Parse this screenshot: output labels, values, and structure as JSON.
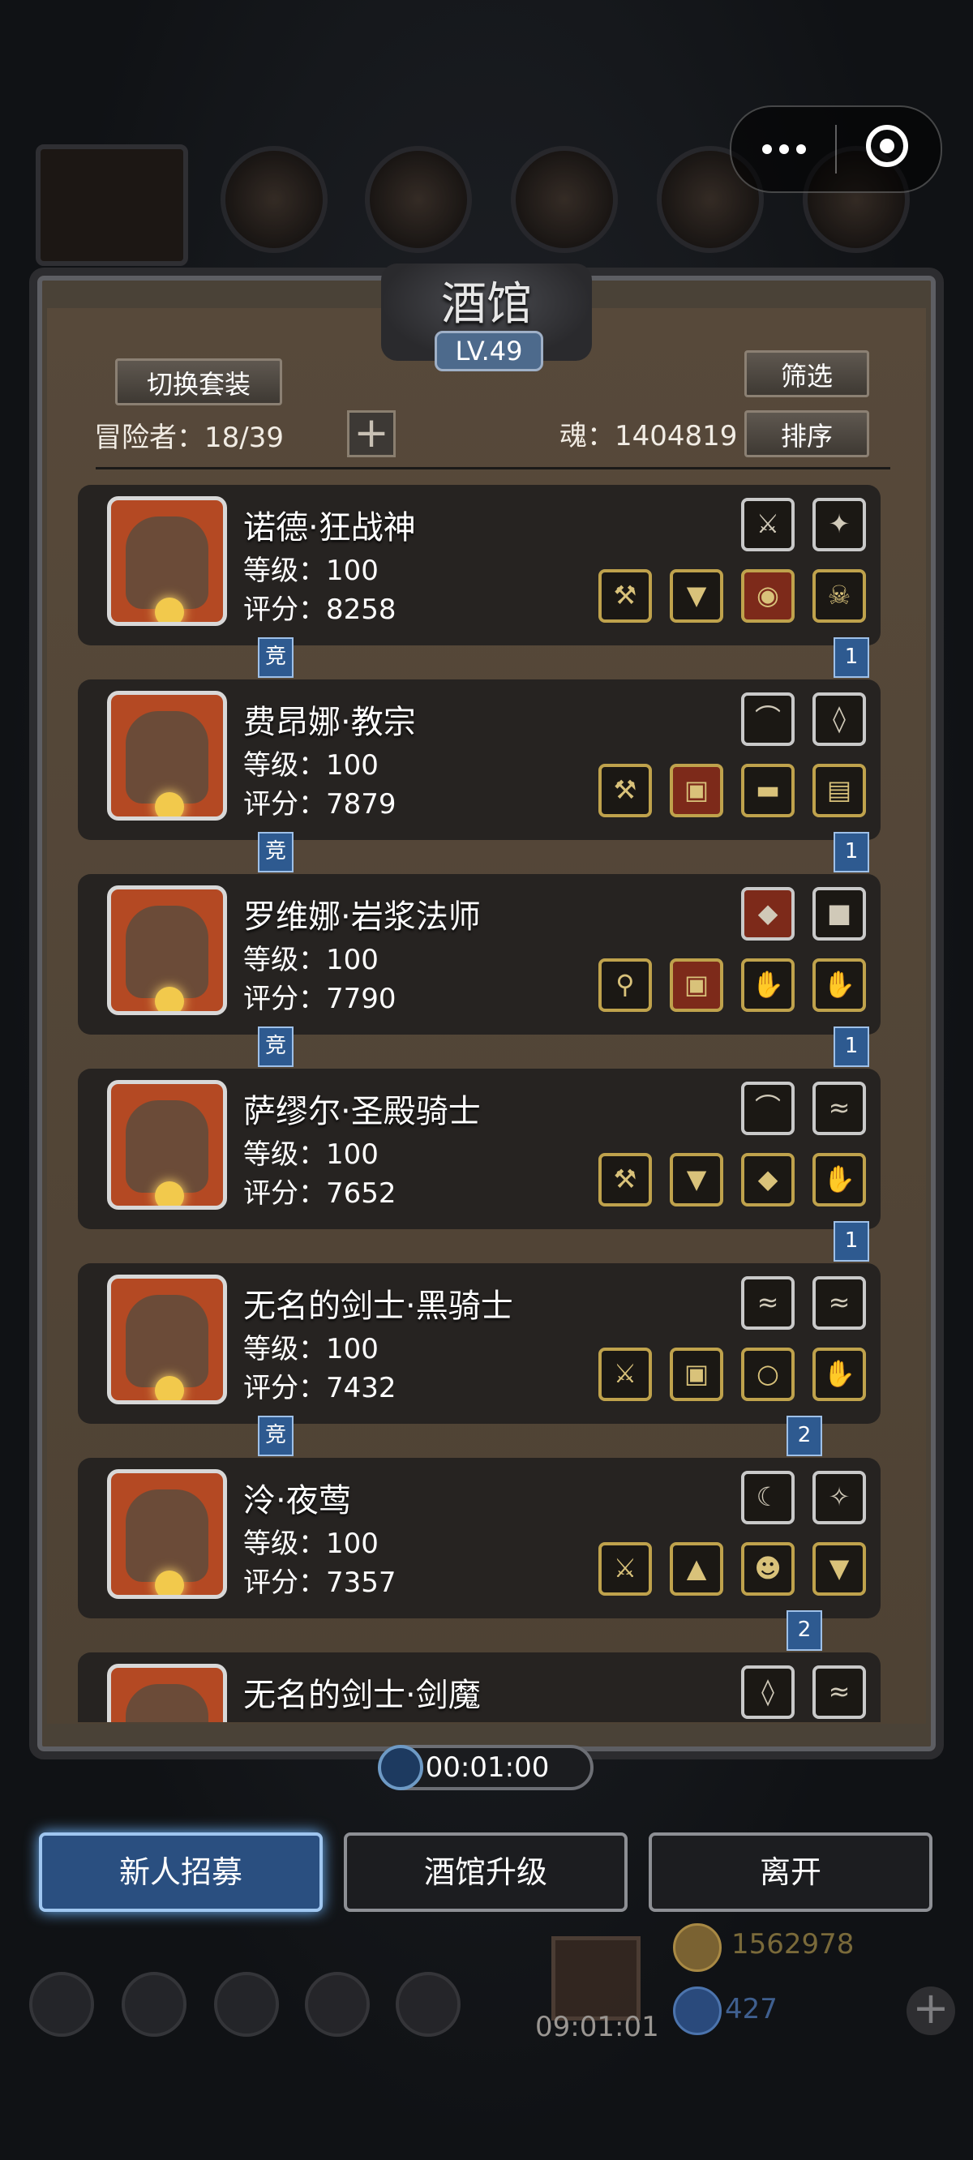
{
  "window": {
    "title": "酒馆",
    "level": "LV.49"
  },
  "toolbar": {
    "switch_outfit": "切换套装",
    "filter": "筛选",
    "sort": "排序",
    "add_label": "+"
  },
  "stats": {
    "adventurers": "冒险者：18/39",
    "souls": "魂：1404819"
  },
  "heroes": [
    {
      "name": "诺德·狂战神",
      "level": "等级：100",
      "score": "评分：8258",
      "top_equip": [
        "sword-icon",
        "lantern-icon"
      ],
      "bottom_equip": [
        "axe-icon",
        "cape-icon",
        "shield-icon",
        "skull-icon"
      ],
      "left_tag": "竞",
      "right_tag": "1"
    },
    {
      "name": "费昂娜·教宗",
      "level": "等级：100",
      "score": "评分：7879",
      "top_equip": [
        "bow-icon",
        "necklace-icon"
      ],
      "bottom_equip": [
        "hammer-icon",
        "armor-icon",
        "belt-icon",
        "scroll-icon"
      ],
      "left_tag": "竞",
      "right_tag": "1"
    },
    {
      "name": "罗维娜·岩浆法师",
      "level": "等级：100",
      "score": "评分：7790",
      "top_equip": [
        "gem-icon",
        "tome-icon"
      ],
      "bottom_equip": [
        "staff-icon",
        "armor-icon",
        "gauntlet-icon",
        "gauntlet-icon"
      ],
      "left_tag": "竞",
      "right_tag": "1"
    },
    {
      "name": "萨缪尔·圣殿骑士",
      "level": "等级：100",
      "score": "评分：7652",
      "top_equip": [
        "bow-icon",
        "bracer-icon"
      ],
      "bottom_equip": [
        "hammer-icon",
        "robe-icon",
        "emerald-icon",
        "glove-icon"
      ],
      "left_tag": "",
      "right_tag": "1"
    },
    {
      "name": "无名的剑士·黑骑士",
      "level": "等级：100",
      "score": "评分：7432",
      "top_equip": [
        "bracer-icon",
        "bracer-icon"
      ],
      "bottom_equip": [
        "sword-icon",
        "chest-icon",
        "ring-icon",
        "gauntlet-icon"
      ],
      "left_tag": "竞",
      "right_tag": "2"
    },
    {
      "name": "泠·夜莺",
      "level": "等级：100",
      "score": "评分：7357",
      "top_equip": [
        "horn-icon",
        "emblem-icon"
      ],
      "bottom_equip": [
        "sword-icon",
        "cloak-icon",
        "mask-icon",
        "cape-icon"
      ],
      "left_tag": "",
      "right_tag": "2"
    },
    {
      "name": "无名的剑士·剑魔",
      "level": "",
      "score": "",
      "top_equip": [
        "necklace-icon",
        "bracer-icon"
      ],
      "bottom_equip": [],
      "left_tag": "",
      "right_tag": ""
    }
  ],
  "timer": "00:01:00",
  "actions": {
    "recruit": "新人招募",
    "upgrade": "酒馆升级",
    "leave": "离开"
  },
  "dock": {
    "countdown": "09:01:01",
    "gold": "1562978",
    "gems": "427"
  },
  "colors": {
    "accent": "#2a4f80",
    "gold": "#c8a24a",
    "frame": "#4a4237"
  }
}
